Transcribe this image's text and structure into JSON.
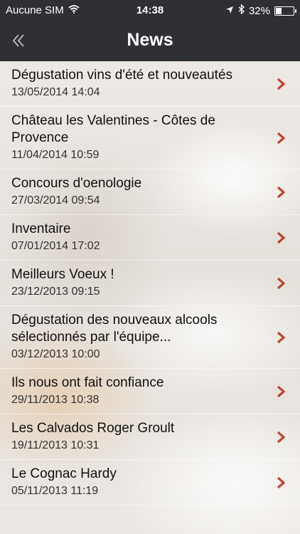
{
  "status": {
    "carrier": "Aucune SIM",
    "time": "14:38",
    "battery": "32%",
    "battery_level": 0.32
  },
  "header": {
    "title": "News",
    "back_icon": "double-chevron-left-icon"
  },
  "colors": {
    "bar": "#2f3033",
    "chevron": "#c2452d"
  },
  "news": [
    {
      "title": "Dégustation vins d'été et nouveautés",
      "date": "13/05/2014 14:04"
    },
    {
      "title": "Château les Valentines - Côtes de Provence",
      "date": "11/04/2014 10:59"
    },
    {
      "title": "Concours d'oenologie",
      "date": "27/03/2014 09:54"
    },
    {
      "title": "Inventaire",
      "date": "07/01/2014 17:02"
    },
    {
      "title": "Meilleurs Voeux !",
      "date": "23/12/2013 09:15"
    },
    {
      "title": "Dégustation des nouveaux alcools sélectionnés par l'équipe...",
      "date": "03/12/2013 10:00"
    },
    {
      "title": "Ils nous ont fait confiance",
      "date": "29/11/2013 10:38"
    },
    {
      "title": "Les Calvados Roger Groult",
      "date": "19/11/2013 10:31"
    },
    {
      "title": "Le Cognac Hardy",
      "date": "05/11/2013 11:19"
    }
  ]
}
